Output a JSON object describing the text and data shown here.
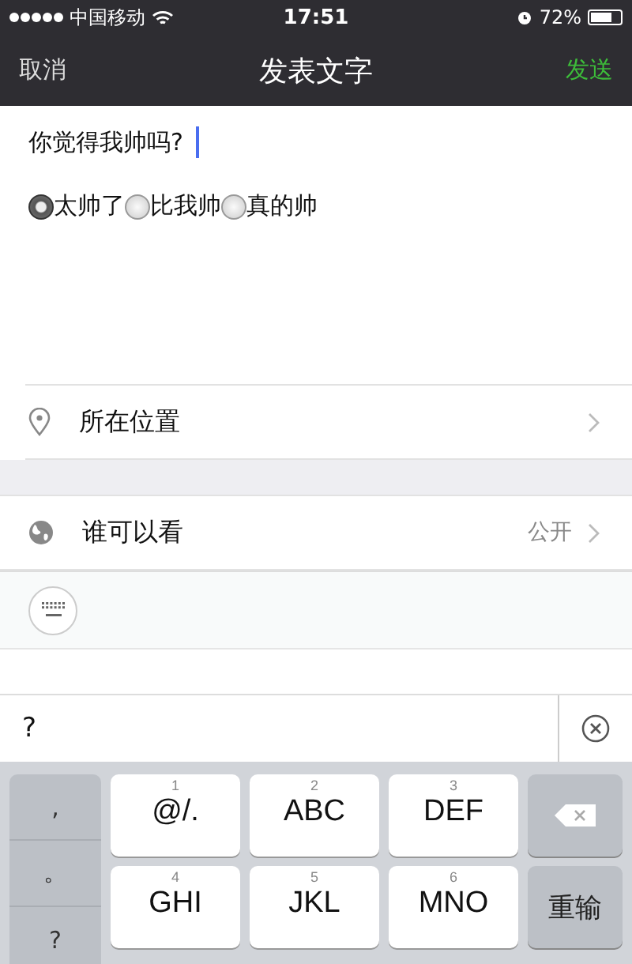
{
  "status_bar": {
    "carrier": "中国移动",
    "time": "17:51",
    "battery": "72%"
  },
  "nav": {
    "cancel": "取消",
    "title": "发表文字",
    "send": "发送"
  },
  "post": {
    "text": "你觉得我帅吗?",
    "options": [
      {
        "label": "太帅了",
        "selected": true
      },
      {
        "label": "比我帅",
        "selected": false
      },
      {
        "label": "真的帅",
        "selected": false
      }
    ]
  },
  "rows": [
    {
      "kind": "location",
      "label": "所在位置"
    },
    {
      "kind": "visibility",
      "label": "谁可以看",
      "value": "公开"
    }
  ],
  "candidate_bar": {
    "text": "?"
  },
  "keyboard": {
    "punctuation": [
      ",",
      "。",
      "?"
    ],
    "keys": [
      {
        "digit": "1",
        "label": "@/."
      },
      {
        "digit": "2",
        "label": "ABC"
      },
      {
        "digit": "3",
        "label": "DEF"
      },
      {
        "digit": "4",
        "label": "GHI"
      },
      {
        "digit": "5",
        "label": "JKL"
      },
      {
        "digit": "6",
        "label": "MNO"
      }
    ],
    "reenter": "重输"
  }
}
